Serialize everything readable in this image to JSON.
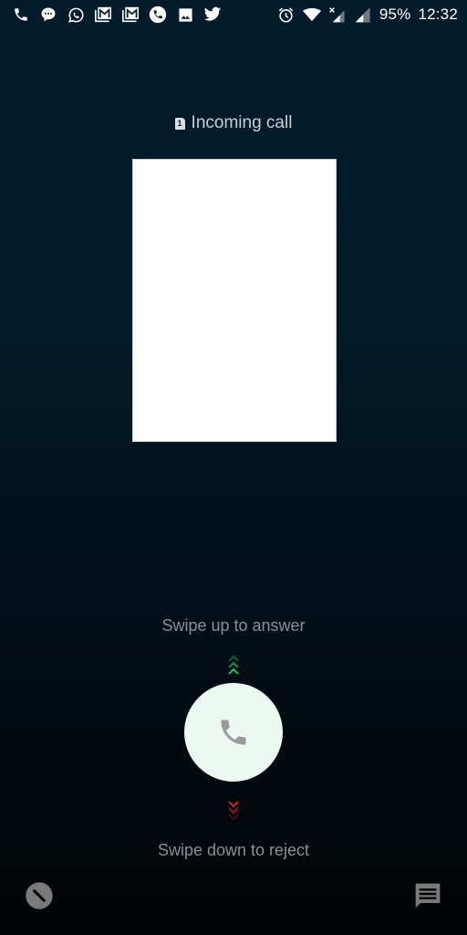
{
  "status_bar": {
    "notification_icons": [
      "phone-icon",
      "chat-bubble-icon",
      "whatsapp-icon",
      "gmail-stack-icon",
      "gmail-stack-icon",
      "phone-circle-icon",
      "image-icon",
      "twitter-icon"
    ],
    "system_icons": [
      "alarm-icon",
      "wifi-icon",
      "signal-no-data-icon",
      "signal-icon"
    ],
    "battery": "95%",
    "time": "12:32"
  },
  "call": {
    "sim_slot": "1",
    "status": "Incoming call"
  },
  "actions": {
    "swipe_up_hint": "Swipe up to answer",
    "swipe_down_hint": "Swipe down to reject"
  },
  "colors": {
    "answer_chevrons": "#1fb957",
    "reject_chevrons": "#d0202a",
    "answer_button": "#eef8f3"
  }
}
